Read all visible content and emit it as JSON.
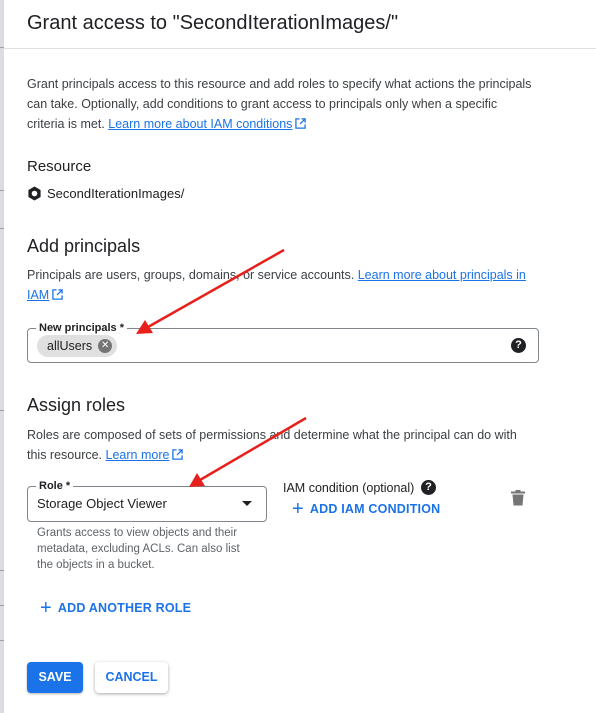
{
  "dialog": {
    "title": "Grant access to \"SecondIterationImages/\"",
    "intro": "Grant principals access to this resource and add roles to specify what actions the principals can take. Optionally, add conditions to grant access to principals only when a specific criteria is met.",
    "intro_link": "Learn more about IAM conditions"
  },
  "resource": {
    "heading": "Resource",
    "name": "SecondIterationImages/"
  },
  "add_principals": {
    "heading": "Add principals",
    "description": "Principals are users, groups, domains, or service accounts.",
    "link": "Learn more about principals in IAM",
    "field_label": "New principals *",
    "chips": [
      "allUsers"
    ]
  },
  "assign_roles": {
    "heading": "Assign roles",
    "description": "Roles are composed of sets of permissions and determine what the principal can do with this resource.",
    "link": "Learn more",
    "role_label": "Role *",
    "role_value": "Storage Object Viewer",
    "role_hint": "Grants access to view objects and their metadata, excluding ACLs. Can also list the objects in a bucket.",
    "iam_condition_label": "IAM condition (optional)",
    "add_iam_condition": "ADD IAM CONDITION",
    "add_another_role": "ADD ANOTHER ROLE"
  },
  "actions": {
    "save": "SAVE",
    "cancel": "CANCEL"
  },
  "colors": {
    "primary": "#1a73e8",
    "annotation_arrow": "#e8201c"
  },
  "icons": [
    "external-link-icon",
    "bucket-icon",
    "chip-remove-icon",
    "help-icon",
    "dropdown-caret-icon",
    "plus-icon",
    "trash-icon"
  ]
}
